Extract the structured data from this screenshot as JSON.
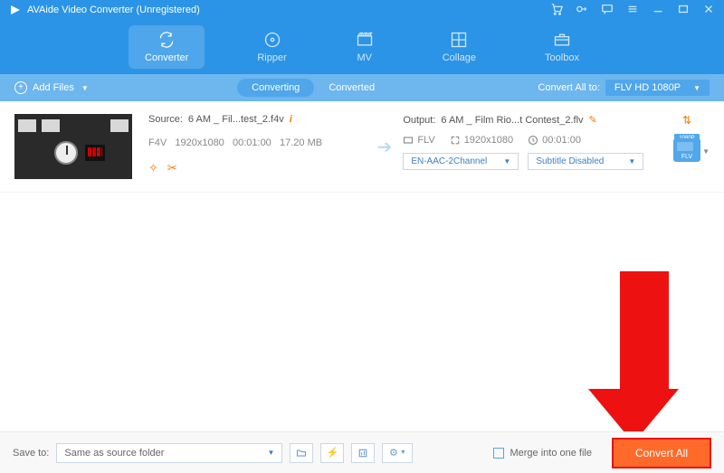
{
  "title": "AVAide Video Converter (Unregistered)",
  "tabs": {
    "converter": "Converter",
    "ripper": "Ripper",
    "mv": "MV",
    "collage": "Collage",
    "toolbox": "Toolbox"
  },
  "subbar": {
    "add_files": "Add Files",
    "converting": "Converting",
    "converted": "Converted",
    "convert_all_to": "Convert All to:",
    "target_format": "FLV HD 1080P"
  },
  "item": {
    "source_label": "Source:",
    "source_name": "6 AM _ Fil...test_2.f4v",
    "src_format": "F4V",
    "src_res": "1920x1080",
    "src_dur": "00:01:00",
    "src_size": "17.20 MB",
    "output_label": "Output:",
    "output_name": "6 AM _ Film Rio...t Contest_2.flv",
    "out_format": "FLV",
    "out_res": "1920x1080",
    "out_dur": "00:01:00",
    "audio_dd": "EN-AAC-2Channel",
    "subtitle_dd": "Subtitle Disabled",
    "badge_top": "1080P",
    "badge_fmt": "FLV"
  },
  "bottom": {
    "save_to": "Save to:",
    "save_path": "Same as source folder",
    "merge": "Merge into one file",
    "convert_all": "Convert All"
  }
}
